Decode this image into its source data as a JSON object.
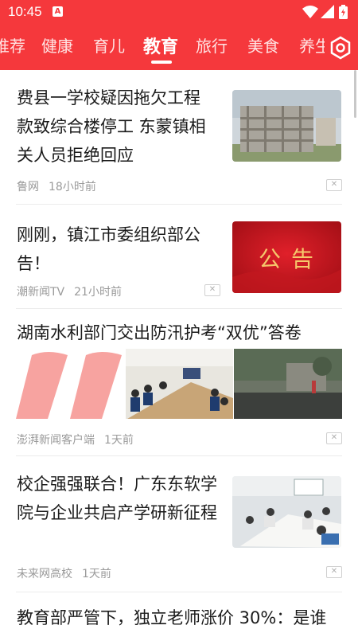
{
  "status_bar": {
    "time": "10:45",
    "notification_badge": "A"
  },
  "tabs": [
    {
      "label": "推荐"
    },
    {
      "label": "健康"
    },
    {
      "label": "育儿"
    },
    {
      "label": "教育",
      "active": true
    },
    {
      "label": "旅行"
    },
    {
      "label": "美食"
    },
    {
      "label": "养生"
    }
  ],
  "colors": {
    "accent": "#f5383c",
    "title_text": "#1b1b1b",
    "meta_text": "#9a9a9a"
  },
  "feed": [
    {
      "title": "费县一学校疑因拖欠工程款致综合楼停工 东蒙镇相关人员拒绝回应",
      "source": "鲁网",
      "time": "18小时前",
      "image": "construction-building-photo"
    },
    {
      "title": "刚刚，镇江市委组织部公告！",
      "source": "潮新闻TV",
      "time": "21小时前",
      "image_text": "公 告"
    },
    {
      "title": "湖南水利部门交出防汛护考“双优”答卷",
      "source": "澎湃新闻客户端",
      "time": "1天前",
      "images": [
        "quote-mark-graphic",
        "meeting-room-photo",
        "flood-street-photo"
      ]
    },
    {
      "title": "校企强强联合！广东东软学院与企业共启产学研新征程",
      "source": "未来网高校",
      "time": "1天前",
      "image": "conference-table-photo"
    },
    {
      "title": "教育部严管下，独立老师涨价 30%：是谁"
    }
  ]
}
